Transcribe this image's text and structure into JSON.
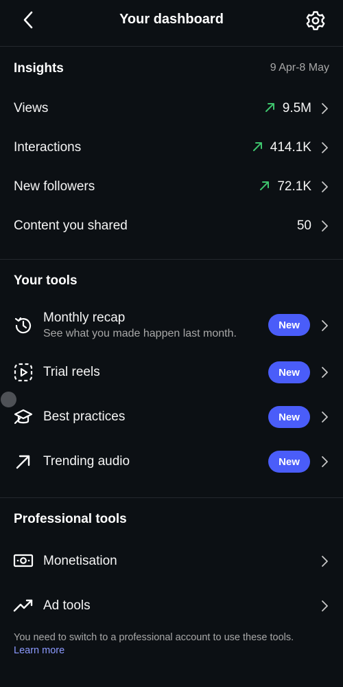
{
  "header": {
    "title": "Your dashboard"
  },
  "insights": {
    "title": "Insights",
    "date_range": "9 Apr-8 May",
    "rows": [
      {
        "label": "Views",
        "value": "9.5M",
        "trend": "up"
      },
      {
        "label": "Interactions",
        "value": "414.1K",
        "trend": "up"
      },
      {
        "label": "New followers",
        "value": "72.1K",
        "trend": "up"
      },
      {
        "label": "Content you shared",
        "value": "50",
        "trend": "none"
      }
    ]
  },
  "your_tools": {
    "title": "Your tools",
    "items": [
      {
        "label": "Monthly recap",
        "sublabel": "See what you made happen last month.",
        "badge": "New",
        "icon": "history-icon"
      },
      {
        "label": "Trial reels",
        "badge": "New",
        "icon": "reels-icon"
      },
      {
        "label": "Best practices",
        "badge": "New",
        "icon": "graduation-cap-icon"
      },
      {
        "label": "Trending audio",
        "badge": "New",
        "icon": "arrow-up-right-icon"
      }
    ]
  },
  "professional_tools": {
    "title": "Professional tools",
    "items": [
      {
        "label": "Monetisation",
        "icon": "money-icon"
      },
      {
        "label": "Ad tools",
        "icon": "trending-up-icon"
      }
    ],
    "footnote": "You need to switch to a professional account to use these tools.",
    "learn_more": "Learn more"
  },
  "colors": {
    "background": "#0c1014",
    "trend_up": "#3ec46d",
    "badge": "#4a5df9",
    "link": "#8c9aff"
  }
}
